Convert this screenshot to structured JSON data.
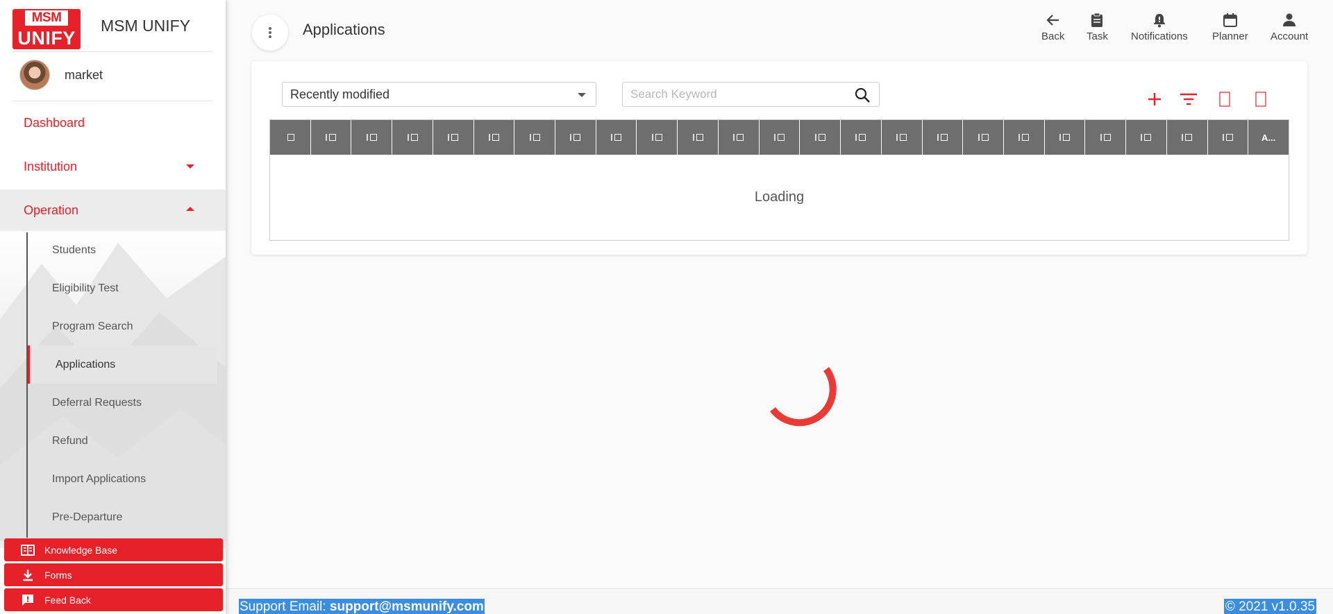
{
  "brand": {
    "logo_top": "MSM",
    "logo_bottom": "UNIFY",
    "name": "MSM UNIFY",
    "brand_color": "#e62129"
  },
  "user": {
    "name": "market"
  },
  "nav": {
    "dashboard": "Dashboard",
    "institution": "Institution",
    "operation": "Operation",
    "sub_items": [
      "Students",
      "Eligibility Test",
      "Program Search",
      "Applications",
      "Deferral Requests",
      "Refund",
      "Import Applications",
      "Pre-Departure"
    ],
    "selected_sub_item": "Applications"
  },
  "side_buttons": [
    {
      "label": "Knowledge Base",
      "icon": "book-icon"
    },
    {
      "label": "Forms",
      "icon": "download-icon"
    },
    {
      "label": "Feed Back",
      "icon": "feedback-icon"
    }
  ],
  "header": {
    "title": "Applications",
    "actions": [
      {
        "label": "Back",
        "icon": "arrow-back-icon"
      },
      {
        "label": "Task",
        "icon": "clipboard-icon"
      },
      {
        "label": "Notifications",
        "icon": "bell-icon"
      },
      {
        "label": "Planner",
        "icon": "calendar-icon"
      },
      {
        "label": "Account",
        "icon": "person-icon"
      }
    ]
  },
  "toolbar": {
    "sort_value": "Recently modified",
    "search_placeholder": "Search Keyword"
  },
  "grid": {
    "last_column_label": "A...",
    "loading_text": "Loading"
  },
  "footer": {
    "support_label": "Support Email:",
    "support_email": "support@msmunify.com",
    "version": "© 2021 v1.0.35"
  }
}
